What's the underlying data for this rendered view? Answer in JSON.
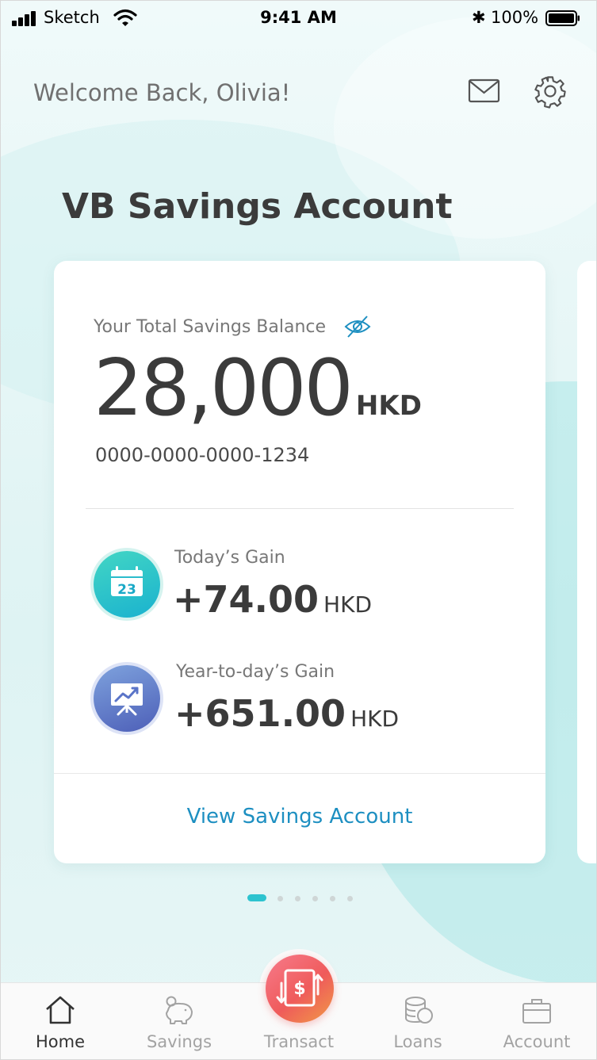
{
  "status_bar": {
    "carrier": "Sketch",
    "time": "9:41 AM",
    "bluetooth": "✱",
    "battery": "100%"
  },
  "header": {
    "welcome": "Welcome Back, Olivia!",
    "icons": [
      "mail-icon",
      "gear-icon"
    ]
  },
  "section_title": "VB Savings Account",
  "card": {
    "balance_label": "Your Total Savings Balance",
    "balance_amount": "28,000",
    "balance_currency": "HKD",
    "account_number": "0000-0000-0000-1234",
    "today_gain": {
      "label": "Today’s Gain",
      "value": "+74.00",
      "currency": "HKD",
      "icon_day": "23"
    },
    "ytd_gain": {
      "label": "Year-to-day’s Gain",
      "value": "+651.00",
      "currency": "HKD"
    },
    "view_link": "View Savings Account"
  },
  "pager": {
    "total": 6,
    "active_index": 0
  },
  "tabbar": {
    "home": "Home",
    "savings": "Savings",
    "transact": "Transact",
    "loans": "Loans",
    "account": "Account"
  },
  "colors": {
    "accent": "#1d8fc1",
    "active_dot": "#2dc3cf",
    "text_dark": "#3b3b3b",
    "transact_start": "#f77b8c",
    "transact_end": "#f09a45"
  }
}
